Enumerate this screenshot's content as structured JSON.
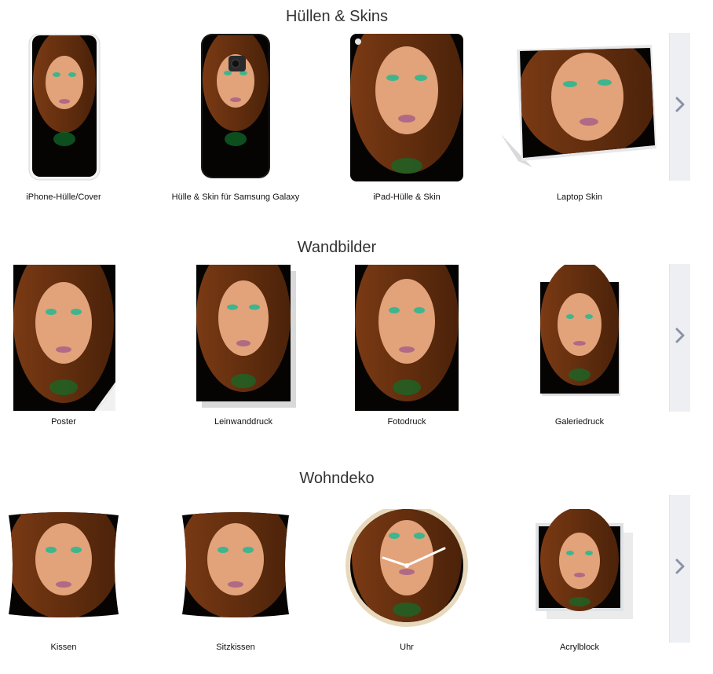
{
  "colors": {
    "hair": "#6b3313",
    "skin": "#e2a27a",
    "eye": "#3fb58e",
    "lip": "#b06a86",
    "sweater": "#0f6e2a",
    "background": "#050403",
    "arrow_panel": "#eeeff3",
    "arrow_icon": "#8a93a6"
  },
  "sections": [
    {
      "title": "Hüllen & Skins",
      "items": [
        {
          "label": "iPhone-Hülle/Cover",
          "product": "phone-case"
        },
        {
          "label": "Hülle & Skin für Samsung Galaxy",
          "product": "samsung-case"
        },
        {
          "label": "iPad-Hülle & Skin",
          "product": "ipad-case"
        },
        {
          "label": "Laptop Skin",
          "product": "laptop-skin"
        }
      ],
      "next_icon": "chevron-right-icon"
    },
    {
      "title": "Wandbilder",
      "items": [
        {
          "label": "Poster",
          "product": "poster"
        },
        {
          "label": "Leinwanddruck",
          "product": "canvas-print"
        },
        {
          "label": "Fotodruck",
          "product": "photo-print"
        },
        {
          "label": "Galeriedruck",
          "product": "gallery-print"
        }
      ],
      "next_icon": "chevron-right-icon"
    },
    {
      "title": "Wohndeko",
      "items": [
        {
          "label": "Kissen",
          "product": "pillow"
        },
        {
          "label": "Sitzkissen",
          "product": "floor-pillow"
        },
        {
          "label": "Uhr",
          "product": "clock"
        },
        {
          "label": "Acrylblock",
          "product": "acrylic-block"
        }
      ],
      "next_icon": "chevron-right-icon"
    }
  ]
}
